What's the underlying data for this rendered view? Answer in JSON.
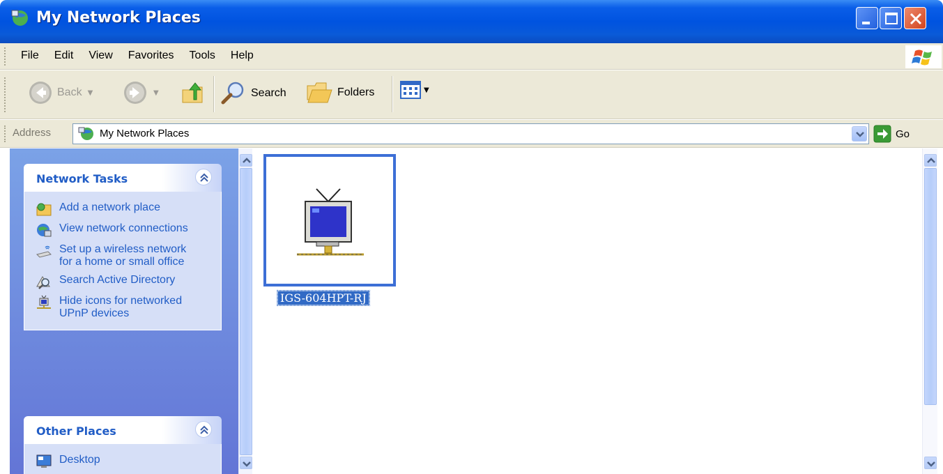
{
  "window": {
    "title": "My Network Places",
    "app_icon": "network-places-icon"
  },
  "menu": {
    "items": [
      {
        "label": "File",
        "accel": "F"
      },
      {
        "label": "Edit",
        "accel": "E"
      },
      {
        "label": "View",
        "accel": "V"
      },
      {
        "label": "Favorites",
        "accel": "a"
      },
      {
        "label": "Tools",
        "accel": "T"
      },
      {
        "label": "Help",
        "accel": "H"
      }
    ]
  },
  "toolbar": {
    "back_label": "Back",
    "search_label": "Search",
    "folders_label": "Folders"
  },
  "address": {
    "label": "Address",
    "value": "My Network Places",
    "go_label": "Go"
  },
  "task_pane": {
    "network_tasks": {
      "title": "Network Tasks",
      "tasks": [
        {
          "label": "Add a network place",
          "icon": "add-network-place-icon"
        },
        {
          "label": "View network connections",
          "icon": "network-connections-icon"
        },
        {
          "label": "Set up a wireless network for a home or small office",
          "icon": "wireless-network-icon"
        },
        {
          "label": "Search Active Directory",
          "icon": "search-directory-icon"
        },
        {
          "label": "Hide icons for networked UPnP devices",
          "icon": "upnp-device-icon"
        }
      ]
    },
    "other_places": {
      "title": "Other Places",
      "items": [
        {
          "label": "Desktop",
          "icon": "desktop-icon"
        }
      ]
    }
  },
  "files": [
    {
      "name": "IGS-604HPT-RJ",
      "icon": "upnp-device-icon",
      "selected": true
    }
  ],
  "colors": {
    "title_bar": "#0053e0",
    "task_link": "#215dc6",
    "selection": "#316ac5"
  }
}
